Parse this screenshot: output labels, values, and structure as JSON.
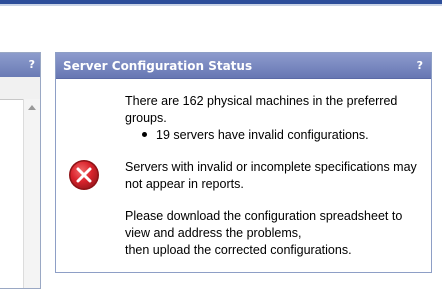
{
  "left_panel": {
    "help_label": "?"
  },
  "status_panel": {
    "title": "Server Configuration Status",
    "help_label": "?",
    "message_1": "There are 162 physical machines in the preferred groups.",
    "bullet_1": "19 servers have invalid configurations.",
    "message_2": "Servers with invalid or incomplete specifications may not appear in reports.",
    "message_3_line_1": "Please download the configuration spreadsheet to view and address the problems,",
    "message_3_line_2": "then upload the corrected configurations."
  },
  "colors": {
    "header_gradient_top": "#8d9bcd",
    "header_gradient_bottom": "#6777b3",
    "error_red": "#d9232c",
    "top_bar": "#2d4e9a"
  },
  "icons": {
    "error": "error-x-circle-icon",
    "help": "help-question-icon",
    "scroll_up": "scroll-up-arrow-icon"
  }
}
